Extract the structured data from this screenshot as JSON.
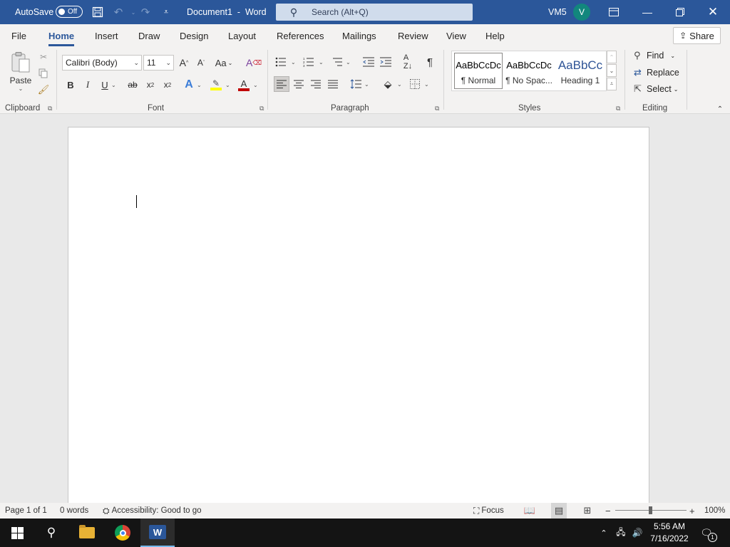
{
  "titlebar": {
    "autosave_label": "AutoSave",
    "autosave_state": "Off",
    "document_title": "Document1  -  Word",
    "search_placeholder": "Search (Alt+Q)",
    "user_name": "VM5",
    "avatar_initial": "V"
  },
  "tabs": [
    "File",
    "Home",
    "Insert",
    "Draw",
    "Design",
    "Layout",
    "References",
    "Mailings",
    "Review",
    "View",
    "Help"
  ],
  "active_tab": "Home",
  "share_label": "Share",
  "ribbon": {
    "clipboard": {
      "group_label": "Clipboard",
      "paste_label": "Paste"
    },
    "font": {
      "group_label": "Font",
      "font_name": "Calibri (Body)",
      "font_size": "11",
      "change_case": "Aa"
    },
    "paragraph": {
      "group_label": "Paragraph"
    },
    "styles": {
      "group_label": "Styles",
      "items": [
        {
          "sample": "AaBbCcDc",
          "name": "¶ Normal"
        },
        {
          "sample": "AaBbCcDc",
          "name": "¶ No Spac..."
        },
        {
          "sample": "AaBbCc",
          "name": "Heading 1"
        }
      ]
    },
    "editing": {
      "group_label": "Editing",
      "find_label": "Find",
      "replace_label": "Replace",
      "select_label": "Select"
    }
  },
  "statusbar": {
    "page": "Page 1 of 1",
    "words": "0 words",
    "accessibility": "Accessibility: Good to go",
    "focus": "Focus",
    "zoom_minus": "−",
    "zoom_plus": "+",
    "zoom_level": "100%"
  },
  "taskbar": {
    "time": "5:56 AM",
    "date": "7/16/2022",
    "notification_count": "1"
  },
  "colors": {
    "word_blue": "#2b579a",
    "ribbon_bg": "#f3f2f1",
    "canvas_bg": "#e9e9e9",
    "avatar_bg": "#12877d",
    "highlight_yellow": "#ffff00",
    "font_color_red": "#c00000"
  }
}
